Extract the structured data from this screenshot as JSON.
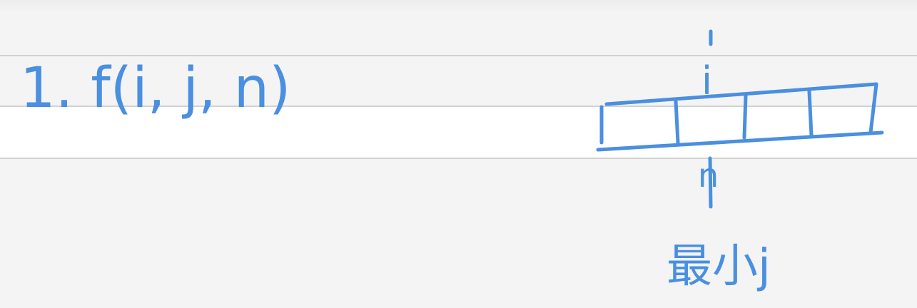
{
  "notes": {
    "formula": "1. f(i, j, n)",
    "diagram": {
      "pointer_top_label": "i",
      "pointer_bottom_label": "n",
      "caption": "最小j"
    }
  },
  "colors": {
    "ink": "#4a8fe0",
    "paper": "#f4f4f4",
    "band": "#ffffff",
    "rule": "#d2d2d2"
  }
}
